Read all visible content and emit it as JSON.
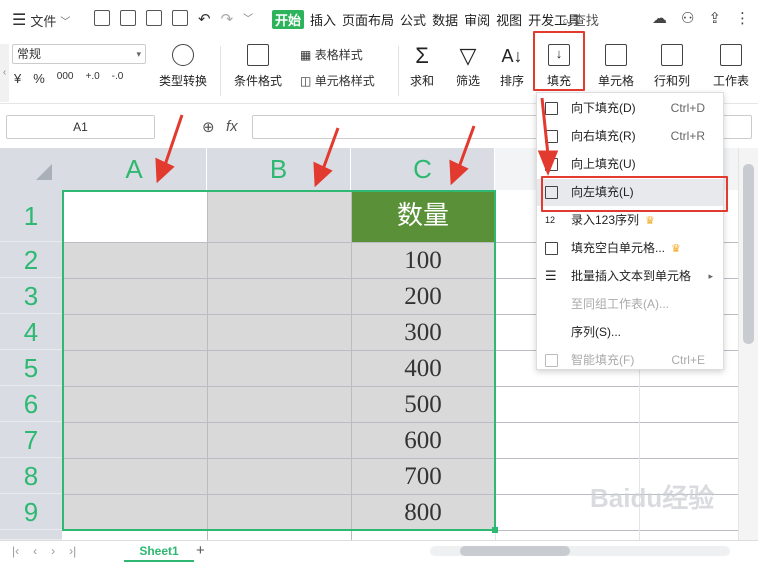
{
  "menubar": {
    "file_label": "文件",
    "tabs": [
      "开始",
      "插入",
      "页面布局",
      "公式",
      "数据",
      "审阅",
      "视图",
      "开发工具"
    ],
    "search_label": "查找"
  },
  "ribbon": {
    "number_format": "常规",
    "type_convert": "类型转换",
    "cond_format": "条件格式",
    "table_style": "表格样式",
    "cell_style": "单元格样式",
    "sum": "求和",
    "filter": "筛选",
    "sort": "排序",
    "fill": "填充",
    "cell": "单元格",
    "rowcol": "行和列",
    "worksheet": "工作表",
    "percent": "%",
    "thousands": "000",
    "yen": "¥",
    "dec_inc": "+.0",
    "dec_dec": "-.0"
  },
  "formula": {
    "cell_ref": "A1",
    "fx": "fx"
  },
  "grid": {
    "columns": [
      "A",
      "B",
      "C"
    ],
    "rows": [
      "1",
      "2",
      "3",
      "4",
      "5",
      "6",
      "7",
      "8",
      "9"
    ],
    "header_cell": "数量",
    "values": [
      "100",
      "200",
      "300",
      "400",
      "500",
      "600",
      "700",
      "800"
    ]
  },
  "dropdown": {
    "items": [
      {
        "label": "向下填充(D)",
        "shortcut": "Ctrl+D"
      },
      {
        "label": "向右填充(R)",
        "shortcut": "Ctrl+R"
      },
      {
        "label": "向上填充(U)",
        "shortcut": ""
      },
      {
        "label": "向左填充(L)",
        "shortcut": ""
      },
      {
        "label": "录入123序列",
        "shortcut": ""
      },
      {
        "label": "填充空白单元格...",
        "shortcut": ""
      },
      {
        "label": "批量插入文本到单元格",
        "shortcut": ""
      },
      {
        "label": "至同组工作表(A)...",
        "shortcut": ""
      },
      {
        "label": "序列(S)...",
        "shortcut": ""
      },
      {
        "label": "智能填充(F)",
        "shortcut": "Ctrl+E"
      }
    ]
  },
  "sheet_tab": "Sheet1",
  "watermark": "Baidu经验",
  "colors": {
    "accent": "#2db35c",
    "header_green": "#5a9138",
    "highlight": "#e23a2e",
    "selection_fill": "#d9d9d9"
  }
}
